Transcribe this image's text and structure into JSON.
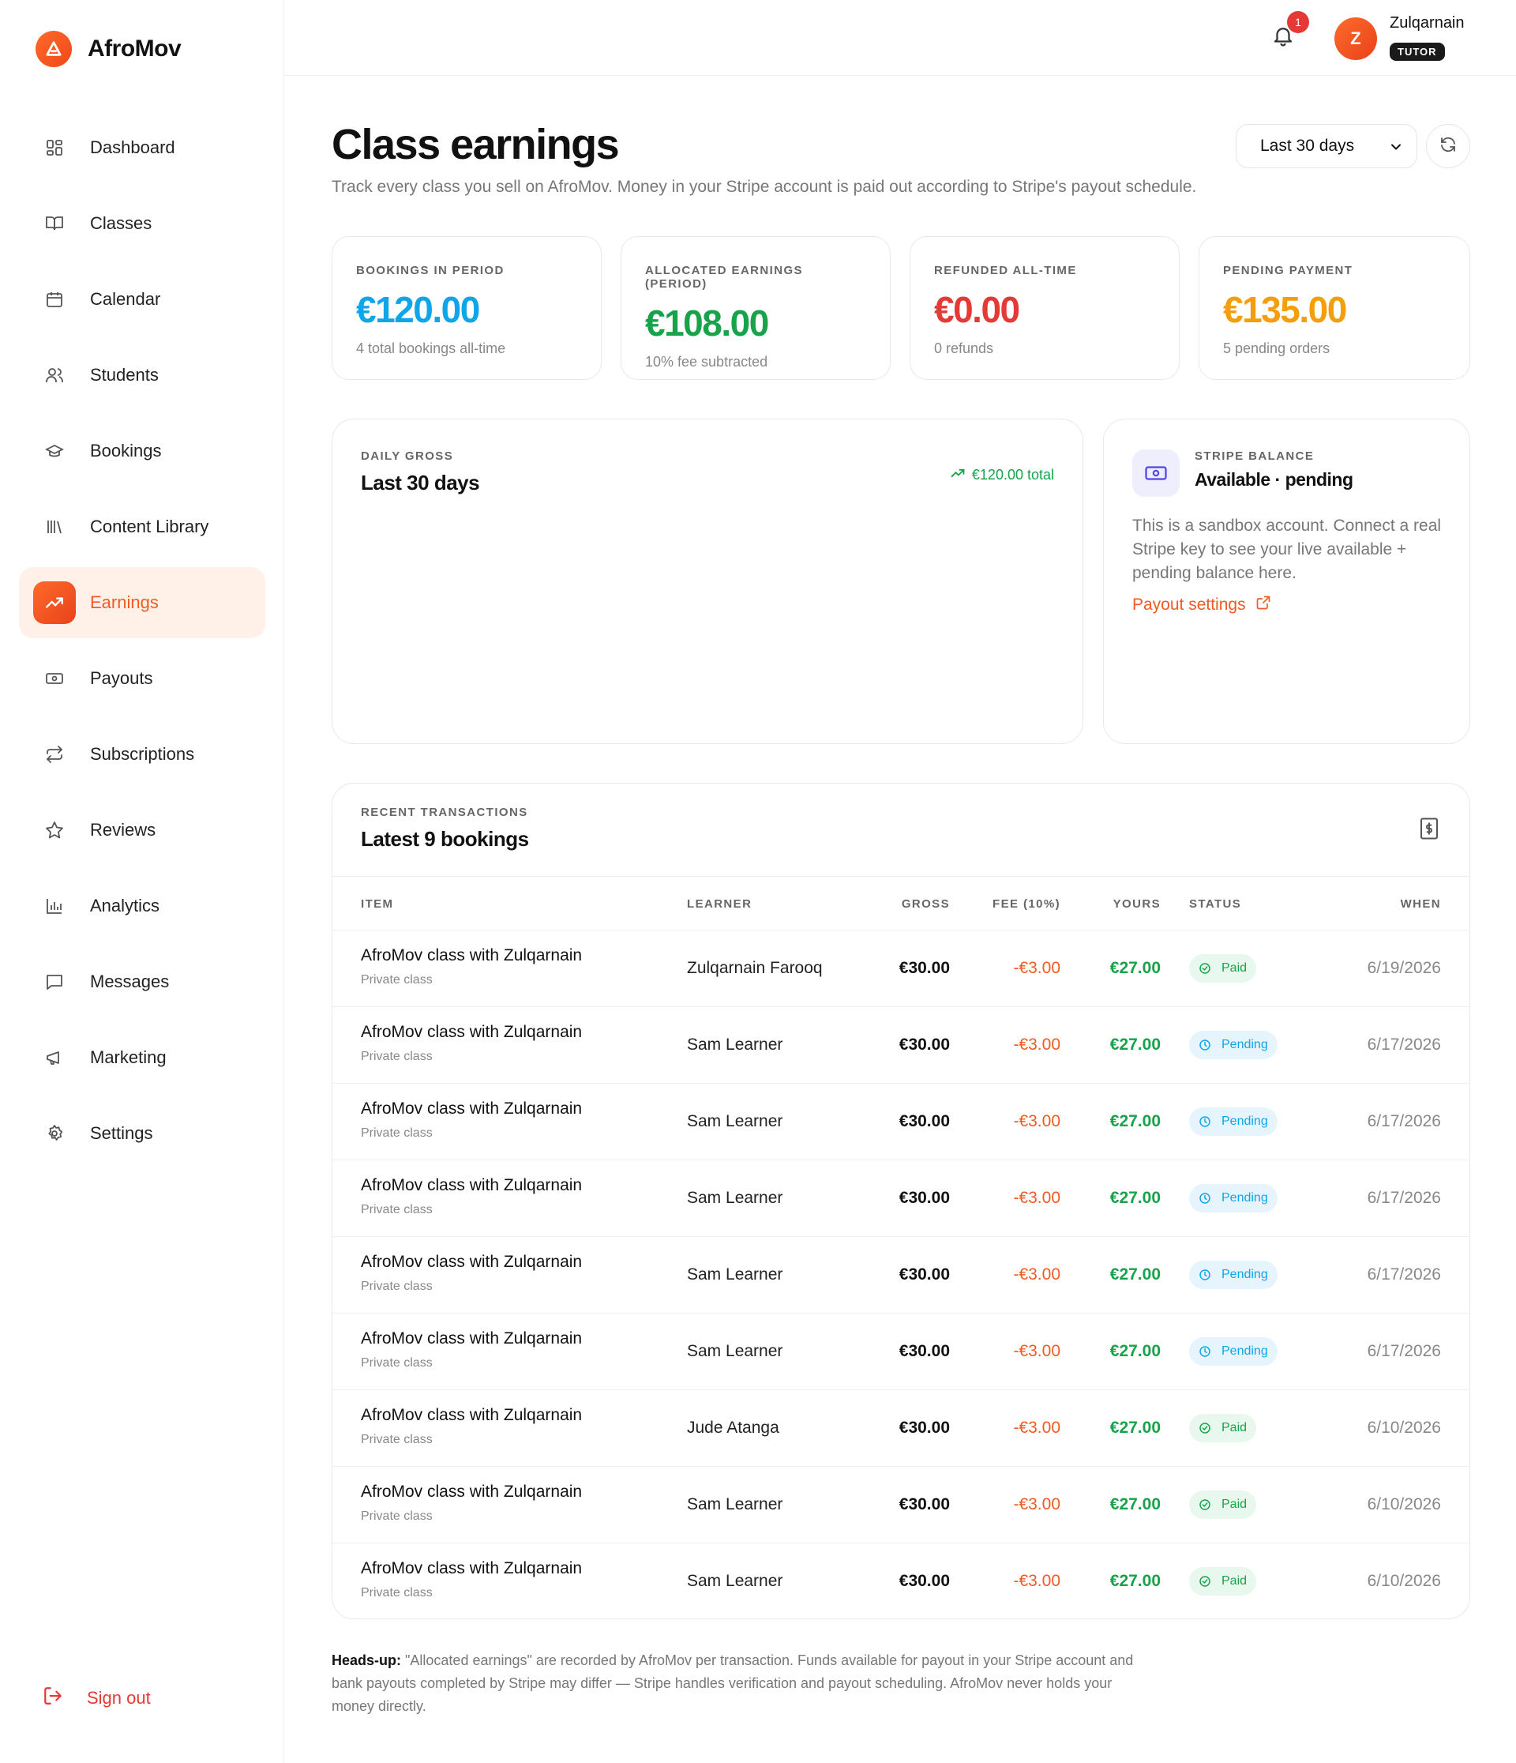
{
  "brand": {
    "name": "AfroMov",
    "accent": "#f15a22"
  },
  "sidebar": {
    "items": [
      {
        "label": "Dashboard",
        "icon": "grid-icon"
      },
      {
        "label": "Classes",
        "icon": "book-icon"
      },
      {
        "label": "Calendar",
        "icon": "calendar-icon"
      },
      {
        "label": "Students",
        "icon": "users-icon"
      },
      {
        "label": "Bookings",
        "icon": "graduation-cap-icon"
      },
      {
        "label": "Content Library",
        "icon": "library-icon"
      },
      {
        "label": "Earnings",
        "icon": "trending-up-icon",
        "active": true
      },
      {
        "label": "Payouts",
        "icon": "banknote-icon"
      },
      {
        "label": "Subscriptions",
        "icon": "repeat-icon"
      },
      {
        "label": "Reviews",
        "icon": "star-icon"
      },
      {
        "label": "Analytics",
        "icon": "bar-chart-icon"
      },
      {
        "label": "Messages",
        "icon": "message-icon"
      },
      {
        "label": "Marketing",
        "icon": "megaphone-icon"
      },
      {
        "label": "Settings",
        "icon": "gear-icon"
      }
    ],
    "signout_label": "Sign out"
  },
  "topbar": {
    "notification_count": "1",
    "avatar_initial": "Z",
    "user_name": "Zulqarnain",
    "user_role": "TUTOR"
  },
  "header": {
    "title": "Class earnings",
    "subtitle": "Track every class you sell on AfroMov. Money in your Stripe account is paid out according to Stripe's payout schedule.",
    "range_selected": "Last 30 days"
  },
  "stats": [
    {
      "label": "BOOKINGS IN PERIOD",
      "value": "€120.00",
      "note": "4 total bookings all-time",
      "color": "#0ea5e9"
    },
    {
      "label": "ALLOCATED EARNINGS (PERIOD)",
      "value": "€108.00",
      "note": "10% fee subtracted",
      "color": "#16a34a"
    },
    {
      "label": "REFUNDED ALL-TIME",
      "value": "€0.00",
      "note": "0 refunds",
      "color": "#e53935"
    },
    {
      "label": "PENDING PAYMENT",
      "value": "€135.00",
      "note": "5 pending orders",
      "color": "#f59e0b"
    }
  ],
  "daily_gross": {
    "kicker": "DAILY GROSS",
    "title": "Last 30 days",
    "total": "€120.00 total"
  },
  "stripe_balance": {
    "kicker": "STRIPE BALANCE",
    "title": "Available · pending",
    "body": "This is a sandbox account. Connect a real Stripe key to see your live available + pending balance here.",
    "link_label": "Payout settings"
  },
  "transactions": {
    "kicker": "RECENT TRANSACTIONS",
    "title": "Latest 9 bookings",
    "columns": {
      "item": "ITEM",
      "learner": "LEARNER",
      "gross": "GROSS",
      "fee": "FEE (10%)",
      "yours": "YOURS",
      "status": "STATUS",
      "when": "WHEN"
    },
    "rows": [
      {
        "item": "AfroMov class with Zulqarnain",
        "sub": "Private class",
        "learner": "Zulqarnain Farooq",
        "gross": "€30.00",
        "fee": "-€3.00",
        "yours": "€27.00",
        "status": "Paid",
        "when": "6/19/2026"
      },
      {
        "item": "AfroMov class with Zulqarnain",
        "sub": "Private class",
        "learner": "Sam Learner",
        "gross": "€30.00",
        "fee": "-€3.00",
        "yours": "€27.00",
        "status": "Pending",
        "when": "6/17/2026"
      },
      {
        "item": "AfroMov class with Zulqarnain",
        "sub": "Private class",
        "learner": "Sam Learner",
        "gross": "€30.00",
        "fee": "-€3.00",
        "yours": "€27.00",
        "status": "Pending",
        "when": "6/17/2026"
      },
      {
        "item": "AfroMov class with Zulqarnain",
        "sub": "Private class",
        "learner": "Sam Learner",
        "gross": "€30.00",
        "fee": "-€3.00",
        "yours": "€27.00",
        "status": "Pending",
        "when": "6/17/2026"
      },
      {
        "item": "AfroMov class with Zulqarnain",
        "sub": "Private class",
        "learner": "Sam Learner",
        "gross": "€30.00",
        "fee": "-€3.00",
        "yours": "€27.00",
        "status": "Pending",
        "when": "6/17/2026"
      },
      {
        "item": "AfroMov class with Zulqarnain",
        "sub": "Private class",
        "learner": "Sam Learner",
        "gross": "€30.00",
        "fee": "-€3.00",
        "yours": "€27.00",
        "status": "Pending",
        "when": "6/17/2026"
      },
      {
        "item": "AfroMov class with Zulqarnain",
        "sub": "Private class",
        "learner": "Jude Atanga",
        "gross": "€30.00",
        "fee": "-€3.00",
        "yours": "€27.00",
        "status": "Paid",
        "when": "6/10/2026"
      },
      {
        "item": "AfroMov class with Zulqarnain",
        "sub": "Private class",
        "learner": "Sam Learner",
        "gross": "€30.00",
        "fee": "-€3.00",
        "yours": "€27.00",
        "status": "Paid",
        "when": "6/10/2026"
      },
      {
        "item": "AfroMov class with Zulqarnain",
        "sub": "Private class",
        "learner": "Sam Learner",
        "gross": "€30.00",
        "fee": "-€3.00",
        "yours": "€27.00",
        "status": "Paid",
        "when": "6/10/2026"
      }
    ]
  },
  "footnote": {
    "lead": "Heads-up:",
    "text": " \"Allocated earnings\" are recorded by AfroMov per transaction. Funds available for payout in your Stripe account and bank payouts completed by Stripe may differ — Stripe handles verification and payout scheduling. AfroMov never holds your money directly."
  }
}
